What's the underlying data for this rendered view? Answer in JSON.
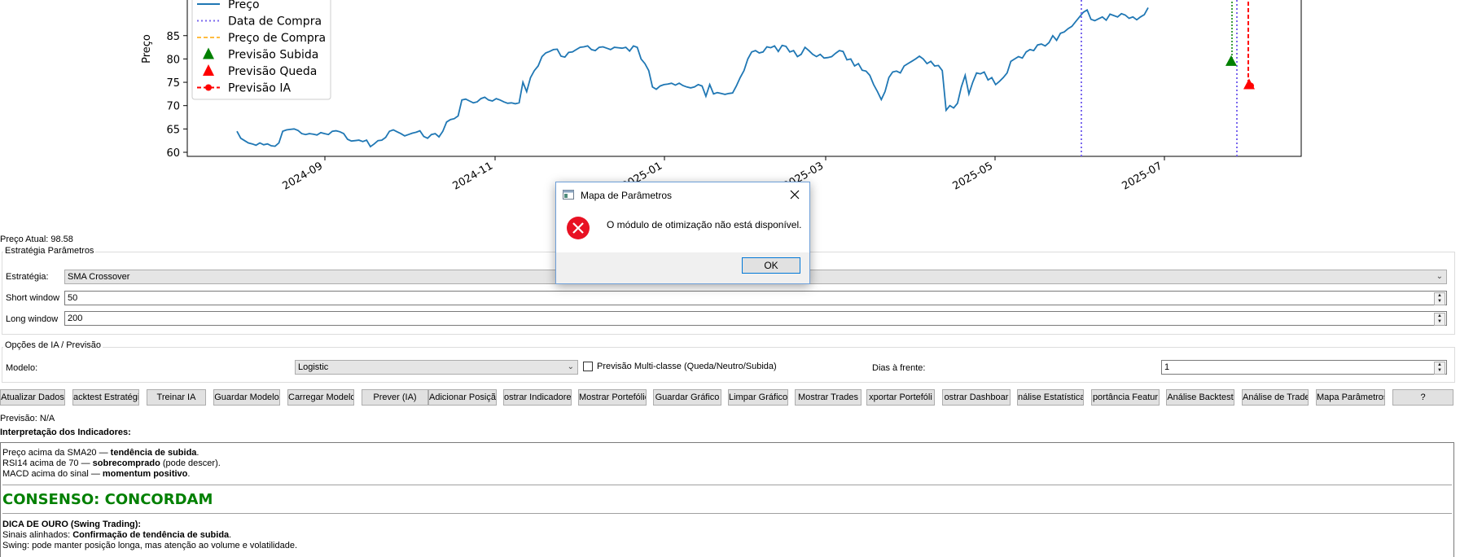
{
  "chart": {
    "y_label": "Preço",
    "y_ticks": [
      "85",
      "80",
      "75",
      "70",
      "65",
      "60"
    ],
    "x_ticks": [
      "2024-09",
      "2024-11",
      "2025-01",
      "2025-03",
      "2025-05",
      "2025-07"
    ],
    "legend": [
      {
        "label": "Preço",
        "style": "solid",
        "color": "#1f77b4"
      },
      {
        "label": "Data de Compra",
        "style": "dotted",
        "color": "#7b68ee"
      },
      {
        "label": "Preço de Compra",
        "style": "dashed",
        "color": "#ffa500"
      },
      {
        "label": "Previsão Subida",
        "style": "triangle",
        "color": "#008000"
      },
      {
        "label": "Previsão Queda",
        "style": "triangle",
        "color": "#ff0000"
      },
      {
        "label": "Previsão IA",
        "style": "dash-dot-marker",
        "color": "#ff0000"
      }
    ],
    "price_series": [
      64.5,
      63.0,
      62.5,
      62.0,
      61.8,
      61.5,
      62.0,
      61.6,
      61.8,
      61.4,
      61.3,
      62.0,
      64.5,
      64.8,
      64.9,
      65.0,
      64.7,
      64.0,
      63.8,
      64.0,
      63.9,
      63.7,
      64.2,
      64.0,
      63.8,
      64.5,
      64.6,
      64.4,
      64.0,
      62.8,
      62.4,
      62.5,
      62.6,
      62.3,
      62.6,
      61.2,
      61.8,
      62.5,
      62.6,
      63.2,
      64.5,
      64.8,
      64.4,
      64.0,
      63.5,
      63.8,
      64.1,
      64.3,
      64.6,
      63.4,
      63.0,
      63.8,
      64.0,
      63.3,
      64.5,
      66.5,
      67.0,
      67.2,
      67.8,
      71.2,
      71.4,
      71.0,
      70.6,
      70.8,
      71.5,
      71.8,
      71.2,
      71.0,
      71.5,
      71.2,
      70.8,
      70.5,
      70.6,
      70.4,
      70.6,
      75.0,
      73.0,
      76.0,
      77.5,
      78.5,
      80.5,
      81.3,
      81.6,
      82.0,
      82.1,
      80.6,
      80.4,
      81.4,
      81.5,
      82.0,
      82.5,
      82.6,
      82.8,
      82.0,
      81.8,
      82.5,
      82.6,
      82.3,
      82.0,
      82.5,
      82.4,
      82.3,
      82.5,
      81.7,
      82.8,
      82.5,
      80.0,
      79.0,
      77.5,
      74.0,
      73.5,
      74.2,
      74.5,
      74.6,
      74.8,
      74.4,
      74.8,
      74.3,
      74.0,
      73.8,
      74.0,
      74.5,
      74.2,
      72.0,
      74.5,
      72.5,
      72.8,
      72.6,
      72.4,
      72.6,
      72.7,
      74.2,
      76.0,
      77.5,
      80.0,
      81.5,
      81.8,
      81.3,
      81.5,
      82.6,
      82.4,
      82.8,
      81.6,
      82.9,
      82.7,
      81.5,
      81.8,
      80.5,
      81.0,
      82.5,
      81.8,
      81.0,
      80.5,
      81.0,
      80.2,
      80.3,
      80.5,
      81.2,
      81.8,
      81.6,
      79.8,
      80.0,
      78.5,
      79.0,
      77.6,
      77.4,
      76.5,
      74.5,
      73.0,
      71.3,
      73.0,
      76.0,
      77.2,
      77.4,
      77.0,
      78.5,
      79.0,
      79.5,
      80.0,
      80.6,
      80.0,
      79.0,
      79.5,
      78.5,
      78.6,
      77.5,
      69.0,
      70.0,
      69.5,
      70.5,
      74.0,
      76.5,
      72.5,
      75.0,
      77.0,
      76.8,
      77.2,
      75.5,
      76.0,
      74.5,
      75.2,
      76.0,
      77.0,
      79.5,
      80.0,
      80.5,
      80.2,
      81.5,
      82.0,
      81.8,
      83.0,
      83.2,
      82.8,
      83.5,
      85.0,
      84.0,
      85.5,
      85.8,
      86.5,
      87.0,
      88.0,
      89.0,
      90.0,
      90.5,
      88.5,
      88.2,
      88.6,
      89.0,
      88.3,
      89.6,
      89.3,
      89.0,
      89.7,
      89.4,
      88.7,
      89.0,
      88.4,
      89.0,
      89.5,
      91.0
    ],
    "buy_date_x": 1328,
    "pred_up_value": 79.4,
    "pred_down_value": 74.4
  },
  "status": {
    "current_price": "Preço Atual: 98.58",
    "prediction": "Previsão: N/A"
  },
  "strategy_group": {
    "title": "Estratégia  Parâmetros",
    "strategy_label": "Estratégia:",
    "strategy_value": "SMA Crossover",
    "short_label": "Short window",
    "short_value": "50",
    "long_label": "Long window",
    "long_value": "200"
  },
  "ai_group": {
    "title": "Opções de IA / Previsão",
    "model_label": "Modelo:",
    "model_value": "Logistic",
    "multiclass_label": "Previsão Multi-classe (Queda/Neutro/Subida)",
    "multiclass_checked": false,
    "days_label": "Dias à frente:",
    "days_value": "1"
  },
  "buttons": [
    "Atualizar Dados",
    "acktest Estratégi",
    "Treinar IA",
    "Guardar Modelo",
    "Carregar Modelo",
    "Prever (IA)",
    "Adicionar Posição",
    "ostrar Indicadore",
    "Mostrar Portefólic",
    "Guardar Gráfico",
    "Limpar Gráfico",
    "Mostrar Trades",
    "xportar Portefóli",
    "ostrar Dashboar",
    "nálise Estatística",
    "portância Featur",
    "Análise Backtest",
    "Análise de Trades",
    "Mapa Parâmetros",
    "?"
  ],
  "interpretation": {
    "heading": "Interpretação dos Indicadores:",
    "line1_prefix": "Preço acima da SMA20 — ",
    "line1_bold": "tendência de subida",
    "line1_suffix": ".",
    "line2_prefix": "RSI14 acima de 70 — ",
    "line2_bold": "sobrecomprado",
    "line2_suffix": " (pode descer).",
    "line3_prefix": "MACD acima do sinal — ",
    "line3_bold": "momentum positivo",
    "line3_suffix": ".",
    "consensus": "CONSENSO: CONCORDAM",
    "consensus_color": "#008000",
    "tip_title": "DICA DE OURO (Swing Trading):",
    "tip_line1_prefix": "Sinais alinhados: ",
    "tip_line1_bold": "Confirmação de tendência de subida",
    "tip_line1_suffix": ".",
    "tip_line2": "Swing: pode manter posição longa, mas atenção ao volume e volatilidade."
  },
  "dialog": {
    "title": "Mapa de Parâmetros",
    "message": "O módulo de otimização não está disponível.",
    "ok_label": "OK",
    "icon": "error-icon"
  }
}
